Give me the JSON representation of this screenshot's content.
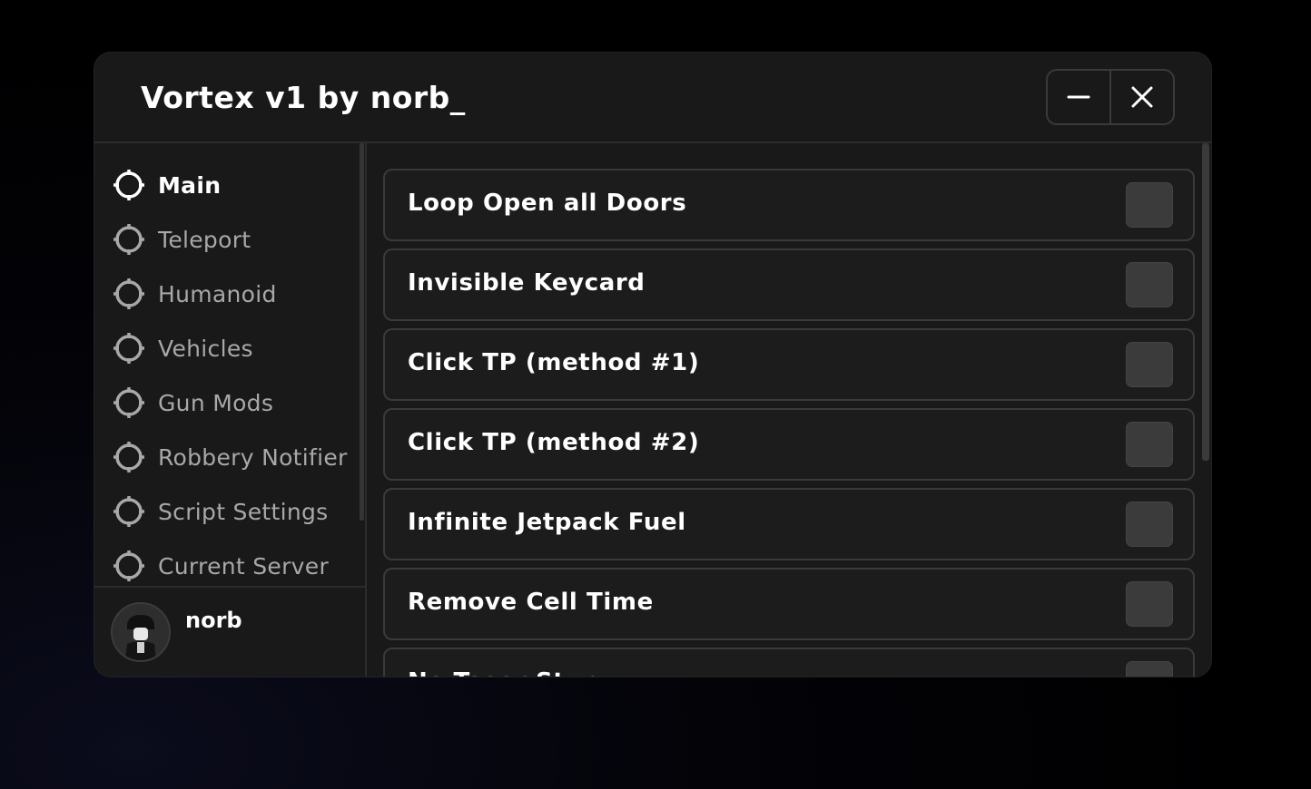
{
  "window": {
    "title": "Vortex v1 by norb_",
    "controls": [
      "minimize-icon",
      "close-icon"
    ]
  },
  "sidebar": {
    "items": [
      {
        "label": "Main",
        "icon": "crosshair-icon",
        "active": true
      },
      {
        "label": "Teleport",
        "icon": "crosshair-icon",
        "active": false
      },
      {
        "label": "Humanoid",
        "icon": "crosshair-icon",
        "active": false
      },
      {
        "label": "Vehicles",
        "icon": "crosshair-icon",
        "active": false
      },
      {
        "label": "Gun Mods",
        "icon": "crosshair-icon",
        "active": false
      },
      {
        "label": "Robbery Notifier",
        "icon": "crosshair-icon",
        "active": false
      },
      {
        "label": "Script Settings",
        "icon": "crosshair-icon",
        "active": false
      },
      {
        "label": "Current Server",
        "icon": "crosshair-icon",
        "active": false
      }
    ]
  },
  "user": {
    "name": "norb",
    "avatar": "avatar-icon"
  },
  "toggles": [
    {
      "label": "Loop Open all Doors",
      "checked": false
    },
    {
      "label": "Invisible Keycard",
      "checked": false
    },
    {
      "label": "Click TP (method #1)",
      "checked": false
    },
    {
      "label": "Click TP (method #2)",
      "checked": false
    },
    {
      "label": "Infinite Jetpack Fuel",
      "checked": false
    },
    {
      "label": "Remove Cell Time",
      "checked": false
    },
    {
      "label": "No Taser Stun",
      "checked": false
    }
  ],
  "colors": {
    "window_bg": "#191919",
    "border": "#3a3a3a",
    "text_active": "#ffffff",
    "text_inactive": "#a8a8a8",
    "checkbox": "#3b3b3b"
  }
}
